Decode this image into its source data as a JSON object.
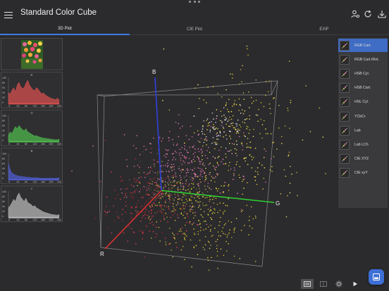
{
  "app": {
    "title": "Standard Color Cube"
  },
  "tabs": [
    {
      "label": "3D Plot",
      "active": true
    },
    {
      "label": "CIE Plot",
      "active": false
    },
    {
      "label": "EXIF",
      "active": false
    }
  ],
  "histograms": [
    {
      "channel": "R",
      "color": "#e05050",
      "ylabels": [
        "100",
        "80",
        "60",
        "40",
        "20",
        "0"
      ],
      "xlabels": [
        "0",
        "40",
        "80",
        "120",
        "160",
        "200",
        "240"
      ]
    },
    {
      "channel": "G",
      "color": "#4fc04f",
      "ylabels": [
        "100",
        "80",
        "60",
        "40",
        "20",
        "0"
      ],
      "xlabels": [
        "0",
        "40",
        "80",
        "120",
        "160",
        "200",
        "240"
      ]
    },
    {
      "channel": "B",
      "color": "#5060d8",
      "ylabels": [
        "100",
        "80",
        "60",
        "40",
        "20",
        "0"
      ],
      "xlabels": [
        "0",
        "40",
        "80",
        "120",
        "160",
        "200",
        "240"
      ]
    },
    {
      "channel": "Y",
      "color": "#bdbdbd",
      "ylabels": [
        "100",
        "80",
        "60",
        "40",
        "20",
        "0"
      ],
      "xlabels": [
        "0",
        "40",
        "80",
        "120",
        "160",
        "200",
        "240"
      ]
    }
  ],
  "axes": {
    "r": "R",
    "g": "G",
    "b": "B"
  },
  "colors": {
    "accent": "#3f6cc4",
    "r_axis": "#e03030",
    "g_axis": "#30d030",
    "b_axis": "#3040e0"
  },
  "modes": [
    {
      "label": "RGB Cart.",
      "selected": true
    },
    {
      "label": "RGB Cart./Rot.",
      "selected": false
    },
    {
      "label": "HSB Cyl.",
      "selected": false
    },
    {
      "label": "HSB Cart.",
      "selected": false
    },
    {
      "label": "HSL Cyl.",
      "selected": false
    },
    {
      "label": "YCbCr",
      "selected": false
    },
    {
      "label": "Lab",
      "selected": false
    },
    {
      "label": "Lab LCh",
      "selected": false
    },
    {
      "label": "CIE XYZ",
      "selected": false
    },
    {
      "label": "CIE xyY",
      "selected": false
    }
  ],
  "toolbar_icons": [
    "person-settings-icon",
    "refresh-icon",
    "download-icon"
  ],
  "bottom_icons": [
    "image-view-icon",
    "split-view-icon",
    "settings-icon",
    "play-icon"
  ]
}
